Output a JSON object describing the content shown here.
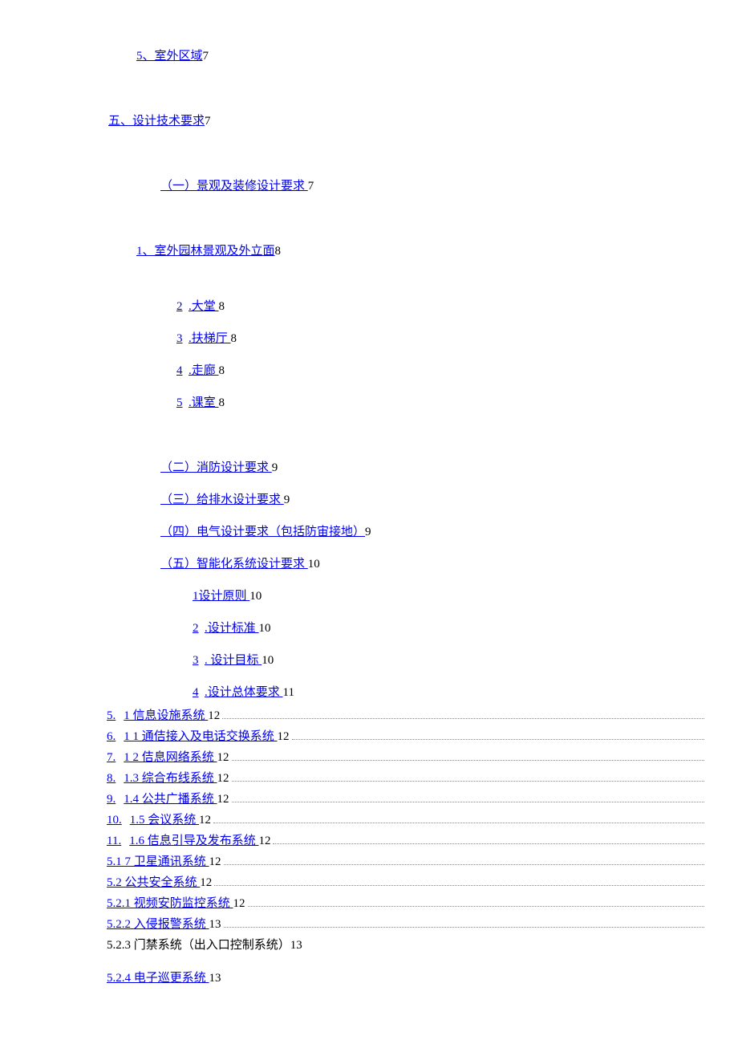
{
  "items": {
    "a1": {
      "label": "5、室外区域",
      "page": "7"
    },
    "a2": {
      "label": "五、设计技术要求",
      "page": "7"
    },
    "a3": {
      "label": " （一）景观及装修设计要求 ",
      "page": "7"
    },
    "a4": {
      "label": "1、室外园林景观及外立面",
      "page": "8"
    },
    "a5n": {
      "num": "2",
      "label": ".大堂 ",
      "page": "8"
    },
    "a6n": {
      "num": "3",
      "label": ".扶梯厅 ",
      "page": "8"
    },
    "a7n": {
      "num": "4",
      "label": ".走廊 ",
      "page": "8"
    },
    "a8n": {
      "num": "5",
      "label": ".课室 ",
      "page": "8"
    },
    "a9": {
      "label": " （二）消防设计要求 ",
      "page": "9"
    },
    "a10": {
      "label": " （三）给排水设计要求 ",
      "page": "9"
    },
    "a11": {
      "label": "（四）电气设计要求（包括防宙接地）",
      "page": "9"
    },
    "a12": {
      "label": " （五）智能化系统设计要求 ",
      "page": "10"
    },
    "a13": {
      "label": "1设计原则 ",
      "page": "10"
    },
    "a14n": {
      "num": "2",
      "label": ".设计标准 ",
      "page": "10"
    },
    "a15n": {
      "num": "3",
      "label": ". 设计目标 ",
      "page": "10"
    },
    "a16n": {
      "num": "4",
      "label": ".设计总体要求 ",
      "page": "11"
    },
    "d1": {
      "num": "5.",
      "label": "1 信息设施系统 ",
      "page": "12"
    },
    "d2": {
      "num": "6.",
      "label": "1 1 通佶接入及电话交换系统 ",
      "page": "12"
    },
    "d3": {
      "num": "7.",
      "label": "1 2 佶息网络系统 ",
      "page": "12"
    },
    "d4": {
      "num": "8.",
      "label": "1.3 综合布线系统 ",
      "page": "12"
    },
    "d5": {
      "num": "9.",
      "label": "1.4 公共广播系统 ",
      "page": "12"
    },
    "d6": {
      "num": "10.",
      "label": "1.5 会议系统 ",
      "page": "12"
    },
    "d7": {
      "num": "11.",
      "label": "1.6 佶息引导及发布系统 ",
      "page": "12"
    },
    "s1": {
      "label": "5.1 7 卫星通讯系统 ",
      "page": "12"
    },
    "s2": {
      "label": "5.2 公共安全系统 ",
      "page": "12"
    },
    "s3": {
      "label": "5.2.1 视频安防监控系统 ",
      "page": "12"
    },
    "s4": {
      "label": "5.2.2 入侵报警系统 ",
      "page": "13"
    },
    "p1": {
      "label": "5.2.3 门禁系统（出入口控制系统）",
      "page": "13"
    },
    "p2": {
      "label": "5.2.4 电子巡更系统 ",
      "page": "13"
    }
  }
}
